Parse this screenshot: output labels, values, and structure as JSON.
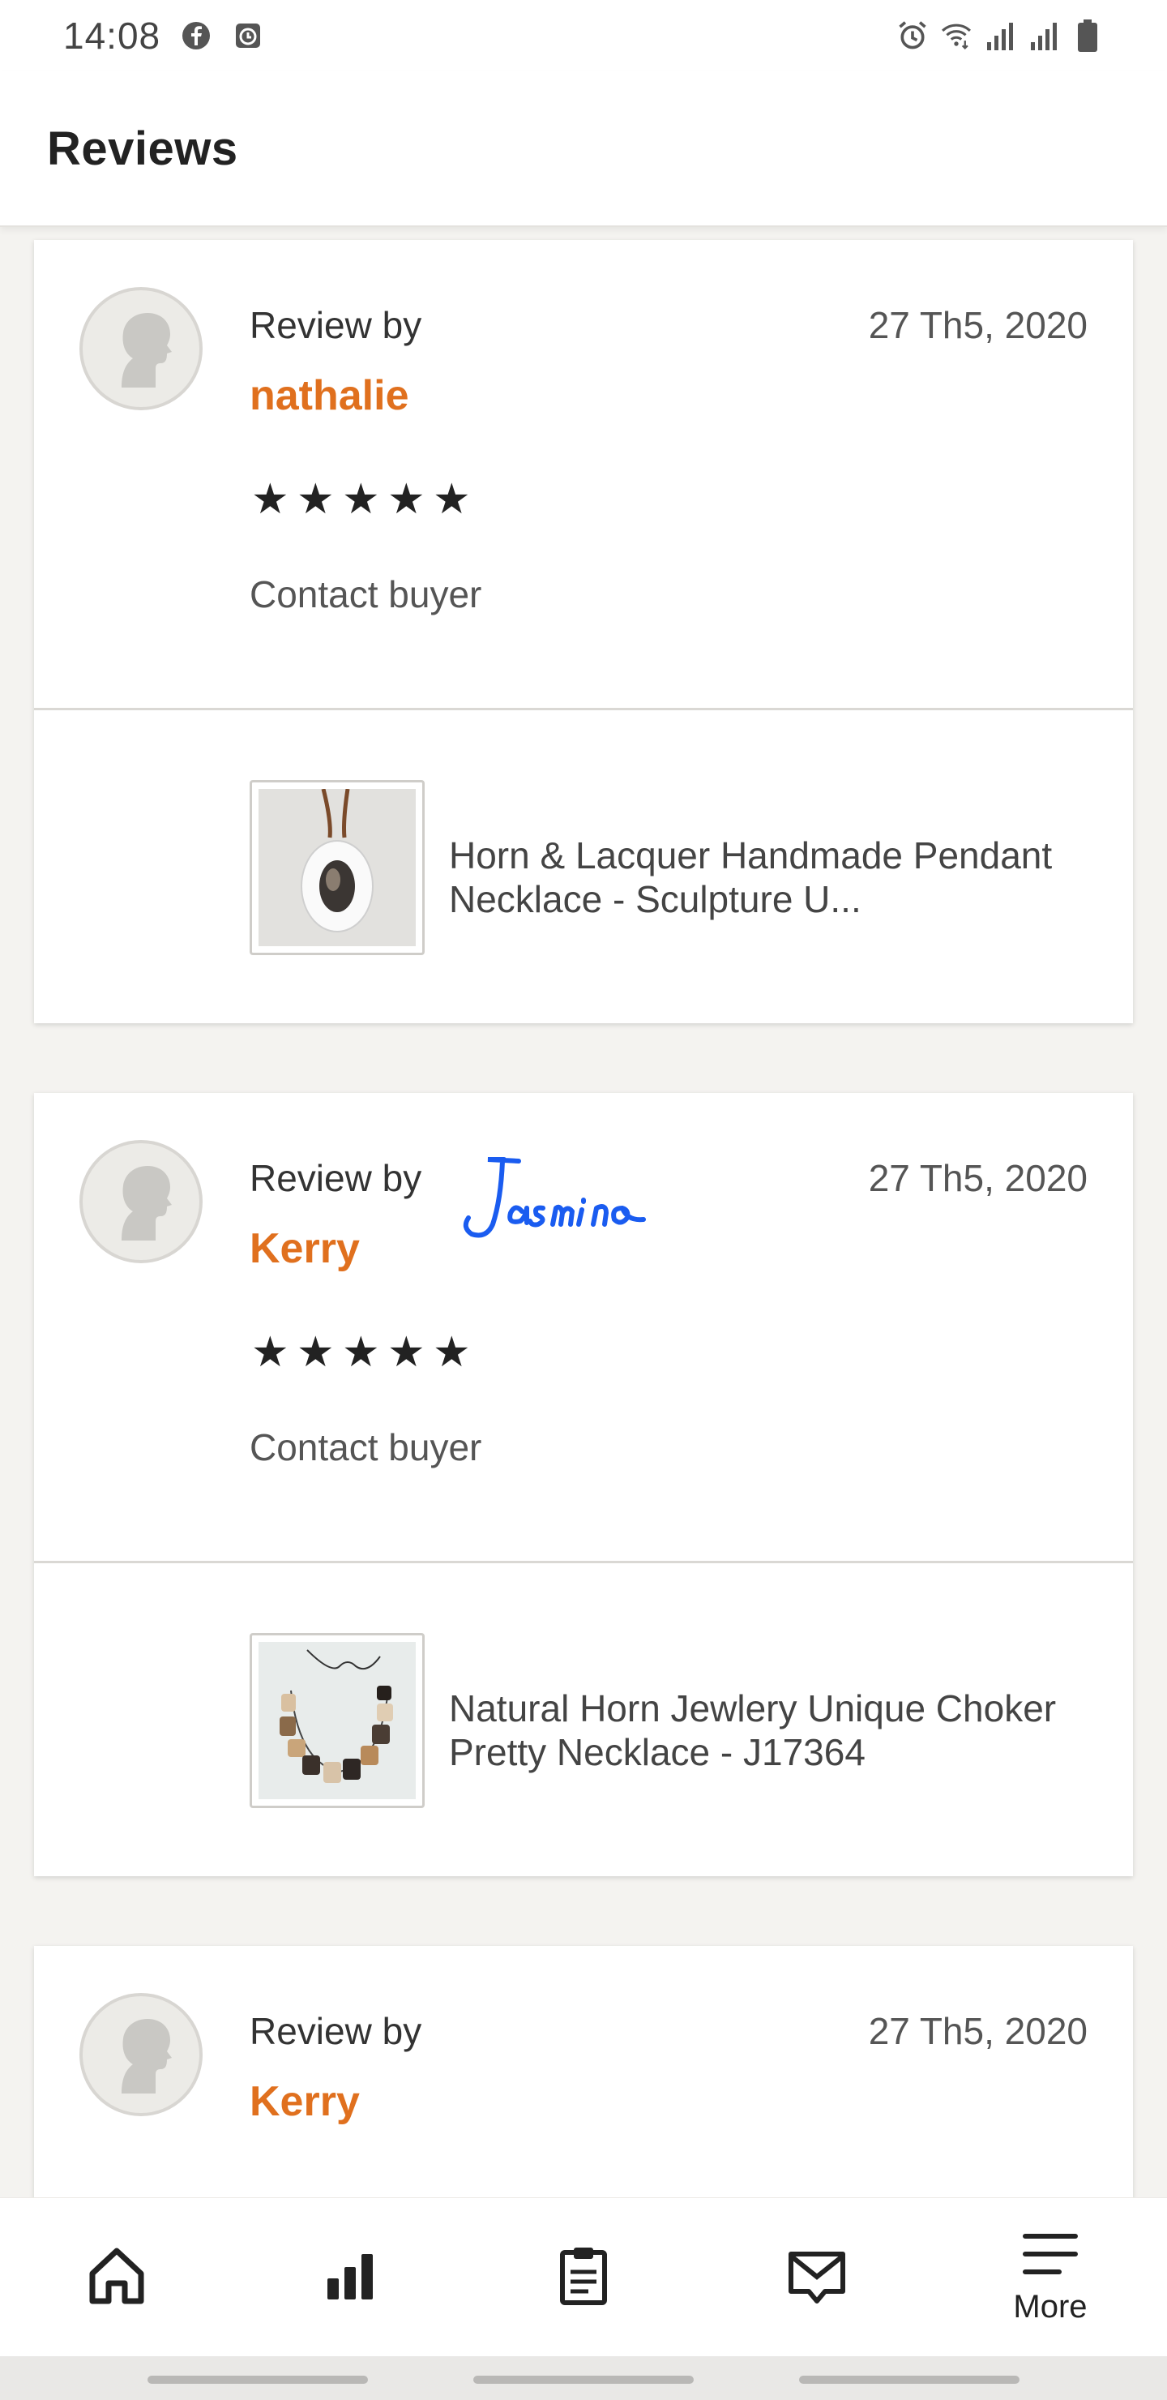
{
  "status_bar": {
    "time": "14:08",
    "icons_left": [
      "facebook-icon",
      "clock-app-icon"
    ],
    "icons_right": [
      "alarm-icon",
      "wifi-icon",
      "signal-1-icon",
      "signal-2-icon",
      "battery-icon"
    ]
  },
  "header": {
    "title": "Reviews"
  },
  "reviews": [
    {
      "review_by_label": "Review by",
      "reviewer": "nathalie",
      "date": "27 Th5, 2020",
      "stars": [
        "★",
        "★",
        "★",
        "★",
        "★"
      ],
      "rating": 5,
      "contact_label": "Contact buyer",
      "product_title": "Horn & Lacquer Handmade Pendant Necklace - Sculpture U..."
    },
    {
      "review_by_label": "Review by",
      "reviewer": "Kerry",
      "date": "27 Th5, 2020",
      "stars": [
        "★",
        "★",
        "★",
        "★",
        "★"
      ],
      "rating": 5,
      "contact_label": "Contact buyer",
      "product_title": "Natural Horn Jewlery Unique Choker Pretty Necklace  - J17364",
      "signature_overlay": "Jasmino"
    },
    {
      "review_by_label": "Review by",
      "reviewer": "Kerry",
      "date": "27 Th5, 2020"
    }
  ],
  "bottom_nav": {
    "items": [
      {
        "icon": "home-icon",
        "label": ""
      },
      {
        "icon": "stats-icon",
        "label": ""
      },
      {
        "icon": "orders-clipboard-icon",
        "label": ""
      },
      {
        "icon": "messages-icon",
        "label": ""
      },
      {
        "icon": "menu-icon",
        "label": "More"
      }
    ]
  },
  "colors": {
    "accent_orange": "#e0701e",
    "background": "#f4f3f0",
    "signature_blue": "#1a5cf0"
  }
}
